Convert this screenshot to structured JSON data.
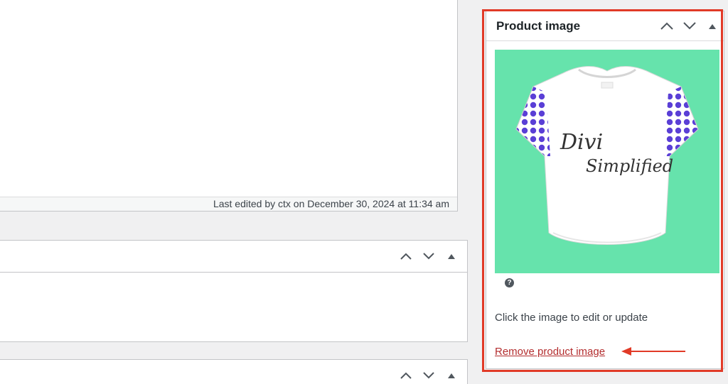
{
  "editor": {
    "last_edited": "Last edited by ctx on December 30, 2024 at 11:34 am"
  },
  "product_image_box": {
    "title": "Product image",
    "image_text_line1": "Divi",
    "image_text_line2": "Simplified",
    "help_symbol": "?",
    "hint": "Click the image to edit or update",
    "remove_link": "Remove product image",
    "image_bg_color": "#66e3ac"
  },
  "icons": {
    "move_up": "chevron-up-icon",
    "move_down": "chevron-down-icon",
    "toggle": "triangle-up-icon",
    "annotation_arrow": "arrow-left-icon"
  },
  "colors": {
    "highlight": "#e13a27",
    "link_danger": "#b32d2e"
  }
}
